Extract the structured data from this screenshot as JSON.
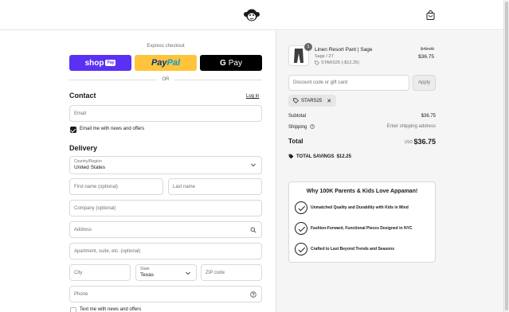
{
  "header": {
    "logo": "monkey-logo",
    "cart_icon": "shopping-bag-icon"
  },
  "express": {
    "label": "Express checkout",
    "shop_pay": {
      "text": "shop",
      "tag": "Pay"
    },
    "paypal": {
      "part1": "Pay",
      "part2": "Pal"
    },
    "gpay": {
      "g": "G",
      "text": "Pay"
    },
    "or": "OR"
  },
  "contact": {
    "title": "Contact",
    "login": "Log in",
    "email_placeholder": "Email",
    "newsletter_label": "Email me with news and offers",
    "newsletter_checked": true
  },
  "delivery": {
    "title": "Delivery",
    "country_label": "Country/Region",
    "country_value": "United States",
    "first_name_placeholder": "First name (optional)",
    "last_name_placeholder": "Last name",
    "company_placeholder": "Company (optional)",
    "address_placeholder": "Address",
    "apartment_placeholder": "Apartment, suite, etc. (optional)",
    "city_placeholder": "City",
    "state_label": "State",
    "state_value": "Texas",
    "zip_placeholder": "ZIP code",
    "phone_placeholder": "Phone",
    "text_offers_label": "Text me with news and offers",
    "text_offers_checked": false
  },
  "order": {
    "product": {
      "name": "Linen Resort Pant | Sage",
      "variant": "Sage / 2T",
      "discount": "STARS25 (-$12.25)",
      "quantity": "1",
      "price_old": "$49.00",
      "price_new": "$36.75"
    },
    "discount_placeholder": "Discount code or gift card",
    "apply_label": "Apply",
    "applied_code": "STARS25",
    "subtotal_label": "Subtotal",
    "subtotal_value": "$36.75",
    "shipping_label": "Shipping",
    "shipping_value": "Enter shipping address",
    "total_label": "Total",
    "currency": "USD",
    "total_value": "$36.75",
    "savings_label": "TOTAL SAVINGS",
    "savings_value": "$12.25"
  },
  "promo": {
    "title": "Why 100K Parents & Kids Love Appaman!",
    "items": [
      "Unmatched Quality and Durability with Kids in Mind",
      "Fashion-Forward, Functional Pieces Designed in NYC",
      "Crafted to Last Beyond Trends and Seasons"
    ]
  },
  "colors": {
    "shop_pay": "#5a31f4",
    "paypal": "#ffc439",
    "gpay": "#000000",
    "text": "#1a1a1a",
    "summary_bg": "#f5f5f5"
  }
}
